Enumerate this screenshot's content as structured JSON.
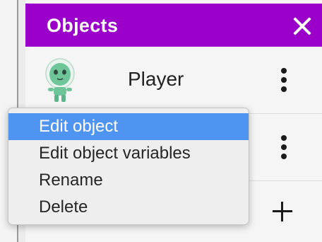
{
  "panel": {
    "title": "Objects",
    "close_icon": "close-icon",
    "accent_color": "#9a00c9"
  },
  "objects": [
    {
      "name": "Player",
      "thumbnail": "green-alien-sprite",
      "menu_icon": "more-vertical-icon"
    },
    {
      "name": "",
      "thumbnail": "",
      "menu_icon": "more-vertical-icon"
    }
  ],
  "add_icon": "plus-icon",
  "context_menu": {
    "highlight_color": "#4f94f0",
    "items": [
      {
        "label": "Edit object",
        "highlighted": true
      },
      {
        "label": "Edit object variables",
        "highlighted": false
      },
      {
        "label": "Rename",
        "highlighted": false
      },
      {
        "label": "Delete",
        "highlighted": false
      }
    ]
  }
}
